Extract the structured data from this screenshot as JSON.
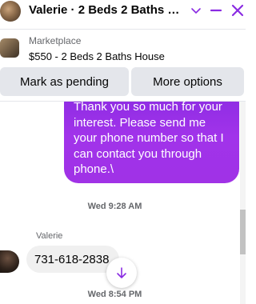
{
  "header": {
    "title": "Valerie · 2 Beds 2 Baths Ho...",
    "accent_color": "#8a2be2"
  },
  "marketplace": {
    "label": "Marketplace",
    "listing": "$550 - 2 Beds 2 Baths House"
  },
  "actions": {
    "pending_label": "Mark as pending",
    "more_label": "More options"
  },
  "messages": {
    "outgoing_text": "Thank you so much for your interest. Please send me your phone number so that I can contact you through phone.\\",
    "time_1": "Wed 9:28 AM",
    "incoming_sender": "Valerie",
    "incoming_text": "731-618-2838",
    "time_2": "Wed 8:54 PM"
  },
  "icons": {
    "chevron": "chevron-down-icon",
    "minimize": "minimize-icon",
    "close": "close-icon",
    "scroll_down": "arrow-down-icon"
  }
}
